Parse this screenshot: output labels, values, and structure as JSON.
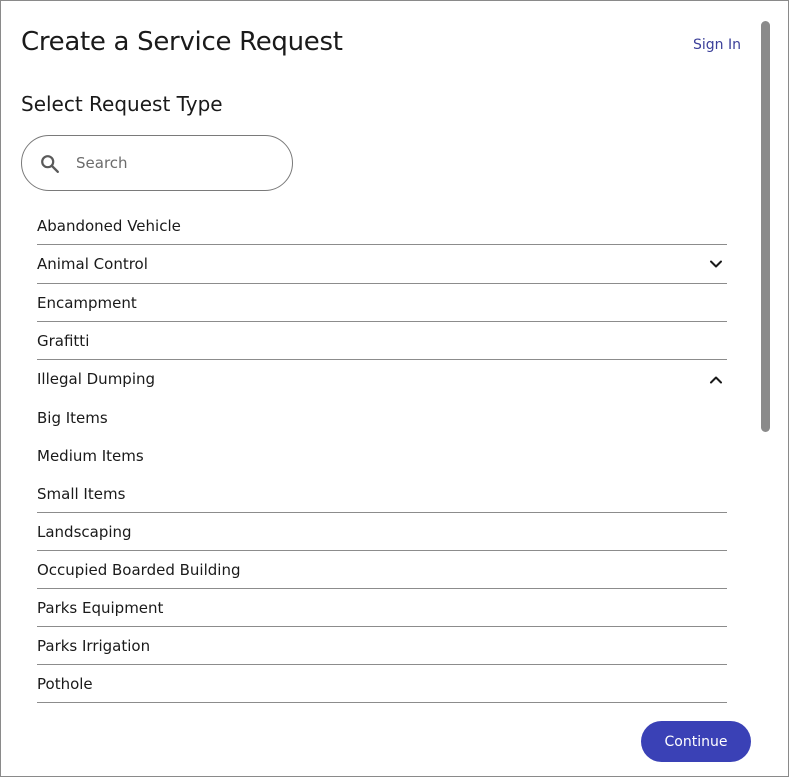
{
  "header": {
    "title": "Create a Service Request",
    "sign_in_label": "Sign In"
  },
  "section": {
    "title": "Select Request Type"
  },
  "search": {
    "placeholder": "Search",
    "value": "",
    "icon": "search-icon"
  },
  "request_types": [
    {
      "label": "Abandoned Vehicle"
    },
    {
      "label": "Animal Control",
      "expandable": true,
      "expanded": false,
      "icon": "chevron-down-icon"
    },
    {
      "label": "Encampment"
    },
    {
      "label": "Grafitti"
    },
    {
      "label": "Illegal Dumping",
      "expandable": true,
      "expanded": true,
      "icon": "chevron-up-icon"
    },
    {
      "label": "Big Items",
      "sub_item": true
    },
    {
      "label": "Medium Items",
      "sub_item": true
    },
    {
      "label": "Small Items",
      "sub_item": true
    },
    {
      "label": "Landscaping"
    },
    {
      "label": "Occupied Boarded Building"
    },
    {
      "label": "Parks Equipment"
    },
    {
      "label": "Parks Irrigation"
    },
    {
      "label": "Pothole"
    }
  ],
  "footer": {
    "continue_label": "Continue"
  },
  "colors": {
    "accent": "#3a41b6",
    "link": "#3b3f99",
    "divider": "#8c8c8c",
    "scrollbar": "#8a8a8a"
  }
}
